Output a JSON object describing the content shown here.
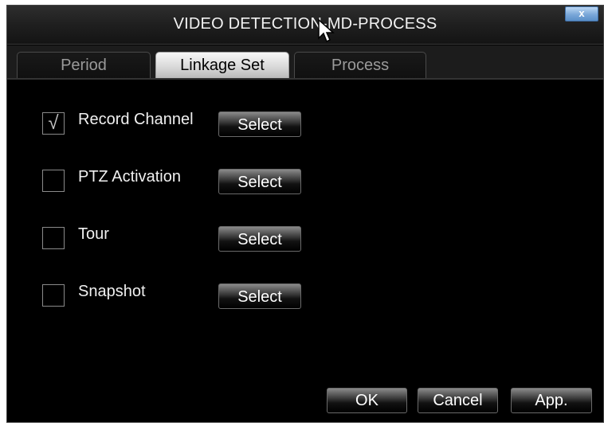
{
  "window": {
    "title": "VIDEO DETECTION-MD-PROCESS",
    "close_label": "x"
  },
  "tabs": [
    {
      "label": "Period",
      "active": false
    },
    {
      "label": "Linkage Set",
      "active": true
    },
    {
      "label": "Process",
      "active": false
    }
  ],
  "linkage_rows": [
    {
      "label": "Record Channel",
      "checked": true,
      "check_glyph": "√",
      "button_label": "Select"
    },
    {
      "label": "PTZ Activation",
      "checked": false,
      "check_glyph": "",
      "button_label": "Select"
    },
    {
      "label": "Tour",
      "checked": false,
      "check_glyph": "",
      "button_label": "Select"
    },
    {
      "label": "Snapshot",
      "checked": false,
      "check_glyph": "",
      "button_label": "Select"
    }
  ],
  "footer": {
    "ok_label": "OK",
    "cancel_label": "Cancel",
    "apply_label": "App."
  },
  "icons": [
    "close-icon",
    "mouse-cursor-icon",
    "checkmark-icon"
  ],
  "colors": {
    "background": "#000000",
    "active_tab": "#d9d9d9",
    "close_button": "#7aa7d8"
  }
}
